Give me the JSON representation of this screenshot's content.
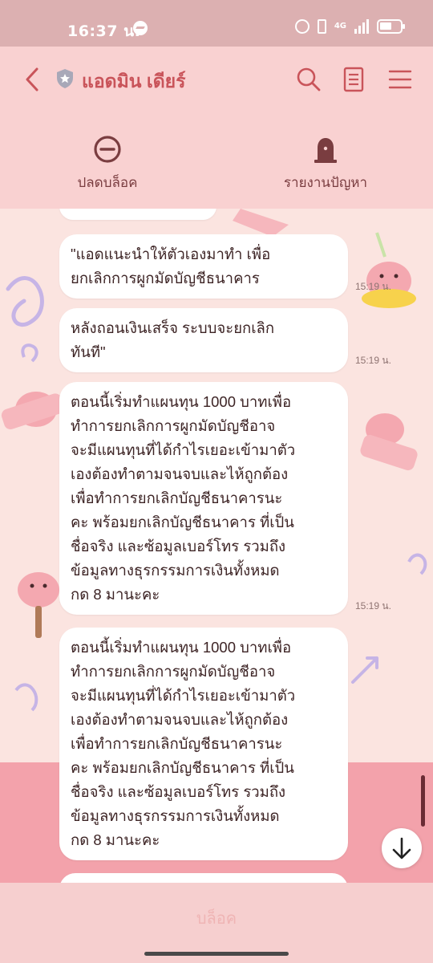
{
  "status_bar": {
    "time": "16:37 น.",
    "network": "4G",
    "icons": [
      "messenger-icon",
      "alarm-icon",
      "vibrate-icon",
      "signal-icon",
      "battery-icon"
    ]
  },
  "header": {
    "title": "แอดมิน เดียร์",
    "icons": [
      "back-icon",
      "shield-icon",
      "search-icon",
      "notes-icon",
      "menu-icon"
    ]
  },
  "actions": {
    "unblock_label": "ปลดบล็อค",
    "report_label": "รายงานปัญหา"
  },
  "messages": [
    {
      "lines": [
        "\"แอดแนะนำให้ตัวเองมาทำ เพื่อ",
        "ยกเลิกการผูกมัดบัญชีธนาคาร"
      ],
      "time": "15:19 น."
    },
    {
      "lines": [
        "หลังถอนเงินเสร็จ ระบบจะยกเลิก",
        "ทันที\""
      ],
      "time": "15:19 น."
    },
    {
      "lines": [
        "ตอนนี้เริ่มทำแผนทุน 1000 บาทเพื่อ",
        "ทำการยกเลิกการผูกมัดบัญชีอาจ",
        "จะมีแผนทุนที่ได้กำไรเยอะเข้ามาตัว",
        "เองต้องทำตามจนจบและไห้ถูกต้อง",
        "เพื่อทำการยกเลิกบัญชีธนาคารนะ",
        "คะ พร้อมยกเลิกบัญชีธนาคาร ที่เป็น",
        "ชื่อจริง และซ้อมูลเบอร์โทร รวมถึง",
        "ข้อมูลทางธุรกรรมการเงินทั้งหมด",
        "กด 8 มานะคะ"
      ],
      "time": "15:19 น."
    },
    {
      "lines": [
        "ตอนนี้เริ่มทำแผนทุน 1000 บาทเพื่อ",
        "ทำการยกเลิกการผูกมัดบัญชีอาจ",
        "จะมีแผนทุนที่ได้กำไรเยอะเข้ามาตัว",
        "เองต้องทำตามจนจบและไห้ถูกต้อง",
        "เพื่อทำการยกเลิกบัญชีธนาคารนะ",
        "คะ พร้อมยกเลิกบัญชีธนาคาร ที่เป็น",
        "ชื่อจริง และซ้อมูลเบอร์โทร รวมถึง",
        "ข้อมูลทางธุรกรรมการเงินทั้งหมด",
        "กด 8 มานะคะ"
      ],
      "time": ""
    }
  ],
  "bottom": {
    "block_label": "บล็อค"
  },
  "colors": {
    "status_bar": "#dcb0b1",
    "header_bg": "#f9d1d1",
    "title": "#c9545a",
    "chat_bg": "#fbe4e0",
    "bubble": "#ffffff",
    "text": "#3d2425"
  }
}
